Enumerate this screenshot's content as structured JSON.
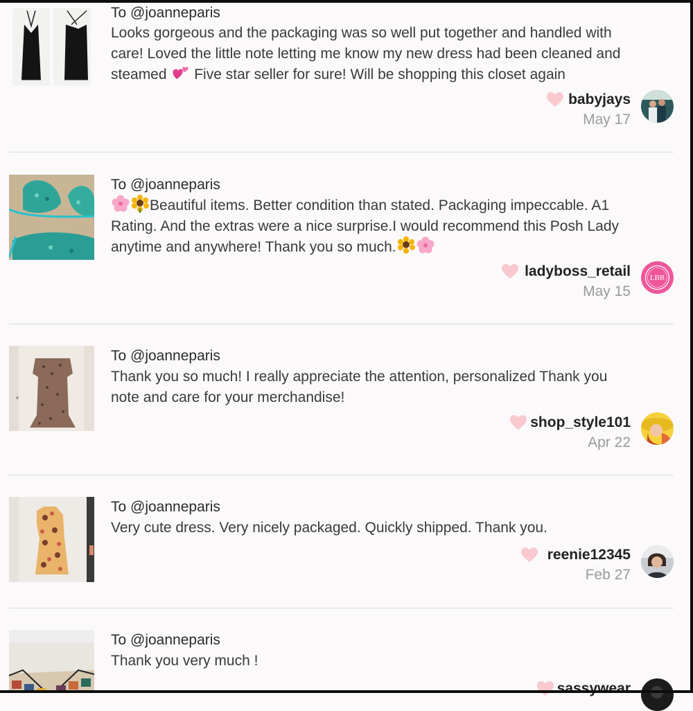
{
  "reviews": [
    {
      "to": "To @joanneparis",
      "text_lines": [
        "Looks gorgeous and the packaging was so well put together and handled with",
        "care! Loved the little note letting me know my new dress had been cleaned and"
      ],
      "text_line3_a": "steamed",
      "text_line3_b": "Five star seller for sure! Will be shopping this closet again",
      "user": "babyjays",
      "date": "May 17",
      "thumb_icon": "black-dress-photo",
      "avatar_icon": "couple-photo-avatar"
    },
    {
      "to": "To @joanneparis",
      "text_line1": "Beautiful items. Better condition than stated. Packaging impeccable. A1",
      "text_line2": "Rating. And the extras were a nice surprise.I would recommend this Posh Lady",
      "text_line3": "anytime and anywhere! Thank you so much.",
      "user": "ladyboss_retail",
      "date": "May 15",
      "thumb_icon": "sequin-bikini-photo",
      "avatar_icon": "lbr-logo-avatar",
      "avatar_text": "LBR"
    },
    {
      "to": "To @joanneparis",
      "text_lines": [
        "Thank you so much! I really appreciate the attention, personalized Thank you",
        "note and care for your merchandise!"
      ],
      "user": "shop_style101",
      "date": "Apr 22",
      "thumb_icon": "leopard-dress-photo",
      "avatar_icon": "hat-woman-avatar"
    },
    {
      "to": "To @joanneparis",
      "text_lines": [
        "Very cute dress. Very nicely packaged. Quickly shipped. Thank you."
      ],
      "user": "reenie12345",
      "date": "Feb 27",
      "thumb_icon": "print-dress-photo",
      "avatar_icon": "woman-photo-avatar"
    },
    {
      "to": "To @joanneparis",
      "text_lines": [
        "Thank you very much !"
      ],
      "user": "sassywear",
      "thumb_icon": "clutch-bag-photo",
      "avatar_icon": "dark-avatar"
    }
  ],
  "colors": {
    "heart": "#f9c9cf",
    "date": "#9b9b9b",
    "divider": "#dcdcdc",
    "background": "#fbf9fa"
  }
}
